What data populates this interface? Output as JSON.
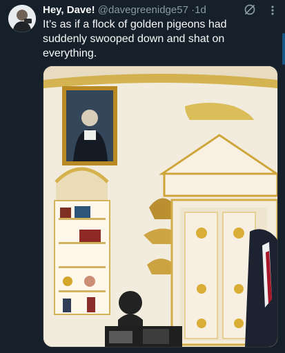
{
  "post": {
    "author": {
      "display_name": "Hey, Dave!",
      "handle": "@davegreenidge57",
      "separator": "·",
      "time": "1d"
    },
    "text": "It’s as if a flock of golden pigeons had suddenly swooped down and shat on everything.",
    "icons": [
      "grok-icon",
      "more-icon"
    ]
  },
  "colors": {
    "background": "#15202b",
    "text": "#f7f9f9",
    "muted": "#8b98a5",
    "gold": "#d4a62a"
  }
}
